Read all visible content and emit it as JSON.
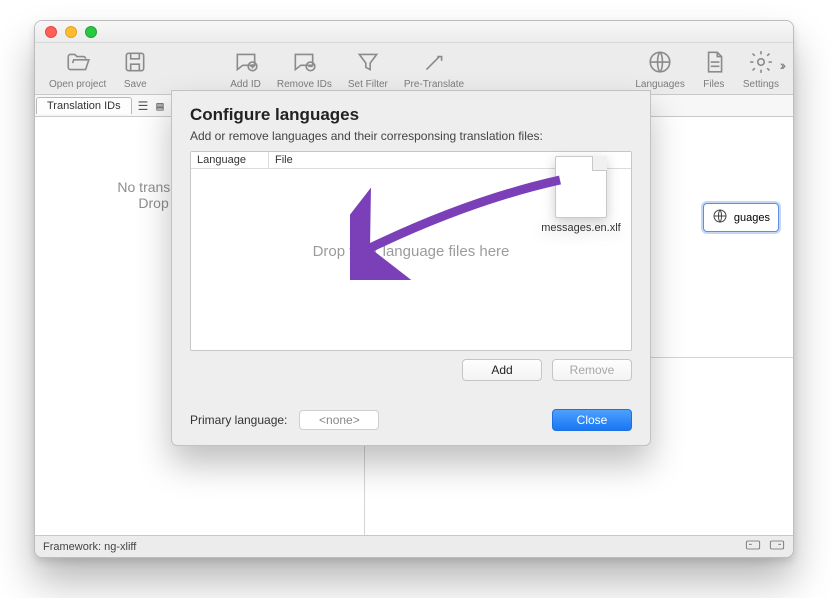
{
  "toolbar": {
    "open_project": "Open project",
    "save": "Save",
    "add_id": "Add ID",
    "remove_ids": "Remove IDs",
    "set_filter": "Set Filter",
    "pre_translate": "Pre-Translate",
    "languages": "Languages",
    "files": "Files",
    "settings": "Settings"
  },
  "tabs": {
    "translation_ids": "Translation IDs"
  },
  "left": {
    "line1": "No translations IDs loaded",
    "line2": "Drop your files here"
  },
  "right": {
    "peek_languages": "guages"
  },
  "sheet": {
    "title": "Configure languages",
    "subtitle": "Add or remove languages and their corresponsing translation files:",
    "col_language": "Language",
    "col_file": "File",
    "drop_hint": "Drop your language files here",
    "add": "Add",
    "remove": "Remove",
    "primary_language_label": "Primary language:",
    "primary_language_value": "<none>",
    "close": "Close"
  },
  "drag": {
    "filename": "messages.en.xlf"
  },
  "footer": {
    "framework": "Framework: ng-xliff"
  }
}
